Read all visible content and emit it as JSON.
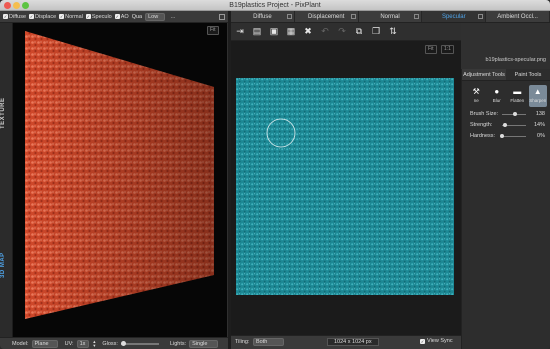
{
  "window": {
    "title": "B19plastics Project - PixPlant",
    "controls": {
      "close_color": "#ee5a52",
      "min_color": "#f5be4f",
      "max_color": "#5cc443"
    }
  },
  "left_panel": {
    "map_toggles": [
      {
        "label": "Diffuse",
        "checked": true
      },
      {
        "label": "Displace",
        "checked": true
      },
      {
        "label": "Normal",
        "checked": true
      },
      {
        "label": "Speculo",
        "checked": true
      },
      {
        "label": "AO",
        "checked": true
      }
    ],
    "quality_label": "Qua",
    "quality_value": "Low",
    "more": "…",
    "vertical_tabs": {
      "texture": "TEXTURE",
      "three_d": "3D MAP"
    },
    "fit_label": "Fit",
    "surface_color": "#d64a2c",
    "bottom": {
      "model_label": "Model:",
      "model_value": "Plane",
      "uv_label": "UV:",
      "uv_value": "1x",
      "gloss_label": "Gloss:",
      "lights_label": "Lights:",
      "lights_value": "Single"
    }
  },
  "tabs": [
    {
      "label": "Diffuse",
      "active": false
    },
    {
      "label": "Displacement",
      "active": false
    },
    {
      "label": "Normal",
      "active": false
    },
    {
      "label": "Specular",
      "active": true
    },
    {
      "label": "Ambient Occl...",
      "active": false
    }
  ],
  "toolbar": {
    "icons": [
      "import-icon",
      "open-folder-icon",
      "save-icon",
      "save-as-icon",
      "close-icon",
      "undo-icon",
      "redo-icon",
      "copy-icon",
      "paste-icon",
      "flip-icon"
    ]
  },
  "canvas": {
    "fit_label": "Fit",
    "ratio_label": "1:1",
    "texture_color": "#1e8d99",
    "tiling_label": "Tiling:",
    "tiling_value": "Both",
    "size_text": "1024 x 1024 px",
    "view_sync_label": "View Sync",
    "view_sync_checked": true
  },
  "side_panel": {
    "filename": "b19plastics-specular.png",
    "tabs": [
      {
        "label": "Adjustment Tools",
        "active": false
      },
      {
        "label": "Paint Tools",
        "active": true
      }
    ],
    "tools": [
      {
        "label": "ne",
        "icon": "clone-icon",
        "selected": false
      },
      {
        "label": "Blur",
        "icon": "blur-drop-icon",
        "selected": false
      },
      {
        "label": "Flatten",
        "icon": "flatten-icon",
        "selected": false
      },
      {
        "label": "Sharpen",
        "icon": "sharpen-icon",
        "selected": true
      }
    ],
    "settings": [
      {
        "label": "Brush Size:",
        "value": "138",
        "fraction": 0.55
      },
      {
        "label": "Strength:",
        "value": "14%",
        "fraction": 0.14
      },
      {
        "label": "Hardness:",
        "value": "0%",
        "fraction": 0.0
      }
    ]
  }
}
